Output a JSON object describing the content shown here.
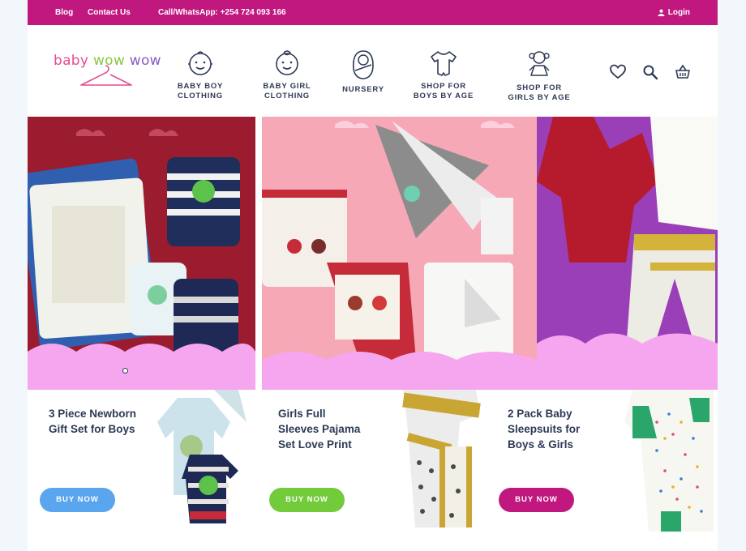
{
  "topbar": {
    "blog": "Blog",
    "contact": "Contact Us",
    "phone": "Call/WhatsApp: +254 724 093 166",
    "login": "Login"
  },
  "logo": {
    "part1": "baby ",
    "part2": "wow",
    "part3": " wow"
  },
  "nav": [
    {
      "label": "BABY BOY\nCLOTHING",
      "icon": "baby-boy-face-icon"
    },
    {
      "label": "BABY GIRL\nCLOTHING",
      "icon": "baby-girl-face-icon"
    },
    {
      "label": "NURSERY",
      "icon": "swaddled-baby-icon"
    },
    {
      "label": "SHOP FOR\nBOYS BY AGE",
      "icon": "bodysuit-icon"
    },
    {
      "label": "SHOP FOR\nGIRLS BY AGE",
      "icon": "girl-doll-icon"
    }
  ],
  "header_icons": [
    "heart-icon",
    "search-icon",
    "basket-icon"
  ],
  "products": [
    {
      "title": "3 Piece Newborn Gift Set for Boys",
      "button": "BUY NOW",
      "color": "#5aa6ee"
    },
    {
      "title": "Girls Full Sleeves Pajama Set Love Print",
      "button": "BUY NOW",
      "color": "#72cb3b"
    },
    {
      "title": "2 Pack Baby Sleepsuits for Boys & Girls",
      "button": "BUY NOW",
      "color": "#c0187f"
    }
  ],
  "colors": {
    "brand": "#c0187f",
    "text": "#2d3a55"
  }
}
